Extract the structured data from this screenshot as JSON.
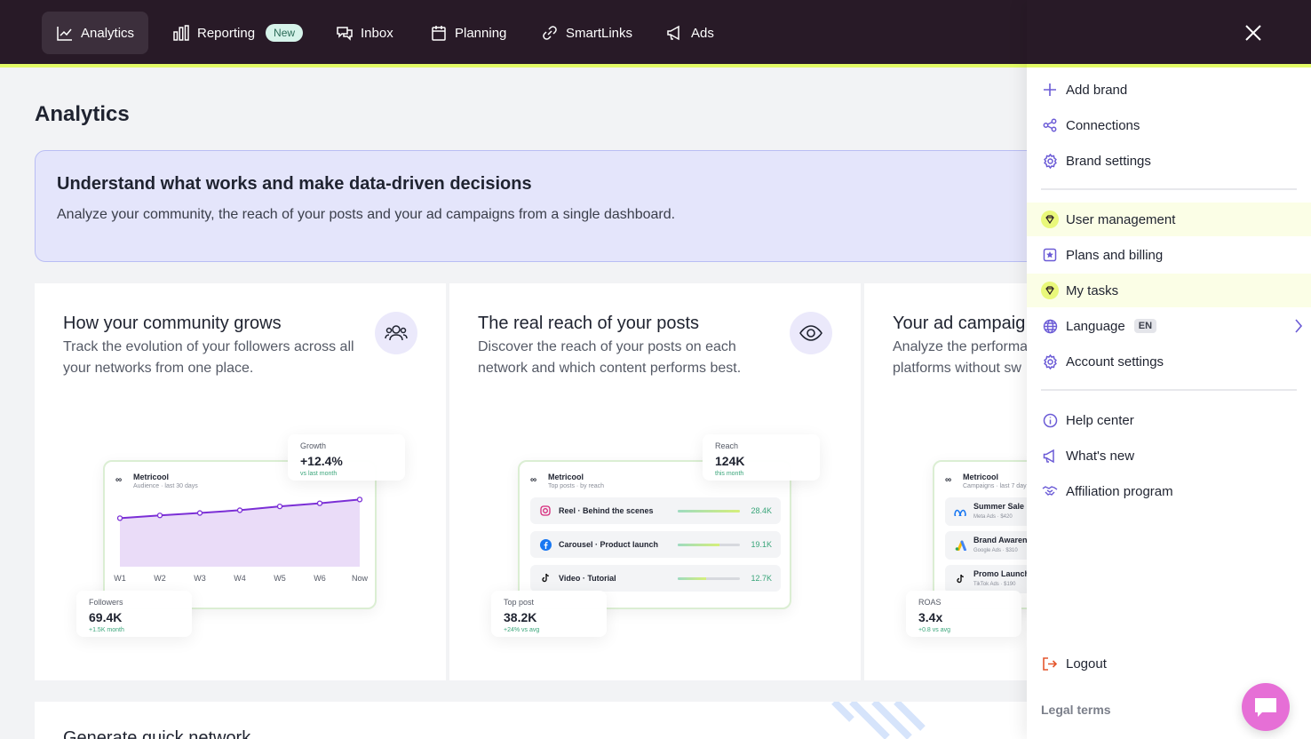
{
  "nav": {
    "items": [
      {
        "label": "Analytics",
        "active": true
      },
      {
        "label": "Reporting",
        "badge": "New"
      },
      {
        "label": "Inbox"
      },
      {
        "label": "Planning"
      },
      {
        "label": "SmartLinks"
      },
      {
        "label": "Ads"
      }
    ]
  },
  "page": {
    "title": "Analytics",
    "banner": {
      "title": "Understand what works and make data-driven decisions",
      "text": "Analyze your community, the reach of your posts and your ad campaigns from a single dashboard."
    }
  },
  "cards": [
    {
      "title": "How your community grows",
      "desc": "Track the evolution of your followers across all your networks from one place.",
      "icon": "community-icon",
      "mini": {
        "brand": "Metricool",
        "sub": "Audience · last 30 days"
      },
      "stat_top": {
        "label": "Growth",
        "value": "+12.4%",
        "delta": "vs last month"
      },
      "stat_bottom": {
        "label": "Followers",
        "value": "69.4K",
        "delta": "+1.5K month"
      }
    },
    {
      "title": "The real reach of your posts",
      "desc": "Discover the reach of your posts on each network and which content performs best.",
      "icon": "eye-icon",
      "mini": {
        "brand": "Metricool",
        "sub": "Top posts · by reach"
      },
      "rows": [
        {
          "label": "Reel · Behind the scenes",
          "value": "28.4K",
          "fill": 1.0,
          "icon": "instagram-icon"
        },
        {
          "label": "Carousel · Product launch",
          "value": "19.1K",
          "fill": 0.67,
          "icon": "facebook-icon"
        },
        {
          "label": "Video · Tutorial",
          "value": "12.7K",
          "fill": 0.45,
          "icon": "tiktok-icon"
        }
      ],
      "stat_top": {
        "label": "Reach",
        "value": "124K",
        "delta": "this month"
      },
      "stat_bottom": {
        "label": "Top post",
        "value": "38.2K",
        "delta": "+24% vs avg"
      }
    },
    {
      "title": "Your ad campaig",
      "desc_l1": "Analyze the performa",
      "desc_l2": "platforms without sw",
      "mini": {
        "brand": "Metricool",
        "sub": "Campaigns · last 7 days"
      },
      "rows": [
        {
          "label": "Summer Sale",
          "sub": "Meta Ads · $420",
          "icon": "meta-icon"
        },
        {
          "label": "Brand Awaren",
          "sub": "Google Ads · $310",
          "icon": "google-ads-icon"
        },
        {
          "label": "Promo Launch",
          "sub": "TikTok Ads · $190",
          "icon": "tiktok-icon"
        }
      ],
      "stat_bottom": {
        "label": "ROAS",
        "value": "3.4x",
        "delta": "+0.8 vs avg"
      }
    }
  ],
  "chart_data": {
    "type": "area",
    "categories": [
      "W1",
      "W2",
      "W3",
      "W4",
      "W5",
      "W6",
      "Now"
    ],
    "values": [
      64.0,
      64.8,
      65.5,
      66.3,
      67.4,
      68.3,
      69.4
    ],
    "ylim": [
      50,
      70
    ],
    "title": "",
    "xlabel": "",
    "ylabel": "",
    "color": "#7b2fd6"
  },
  "bottom": {
    "title": "Generate quick network"
  },
  "menu": {
    "items": [
      {
        "label": "Add brand",
        "icon": "plus-icon"
      },
      {
        "label": "Connections",
        "icon": "share-nodes-icon"
      },
      {
        "label": "Brand settings",
        "icon": "gear-icon"
      },
      {
        "label": "User management",
        "icon": "gem-icon",
        "premium": true
      },
      {
        "label": "Plans and billing",
        "icon": "star-badge-icon"
      },
      {
        "label": "My tasks",
        "icon": "gem-icon",
        "premium": true
      },
      {
        "label": "Language",
        "icon": "globe-icon",
        "badge": "EN"
      },
      {
        "label": "Account settings",
        "icon": "gear-icon"
      },
      {
        "label": "Help center",
        "icon": "info-icon"
      },
      {
        "label": "What's new",
        "icon": "megaphone-icon"
      },
      {
        "label": "Affiliation program",
        "icon": "handshake-icon"
      },
      {
        "label": "Logout",
        "icon": "logout-icon"
      }
    ],
    "legal": "Legal terms"
  },
  "colors": {
    "accent": "#e3fb66",
    "nav_bg": "#281a27",
    "brand_purple": "#6b5bd6",
    "chat": "#e66fd6"
  }
}
